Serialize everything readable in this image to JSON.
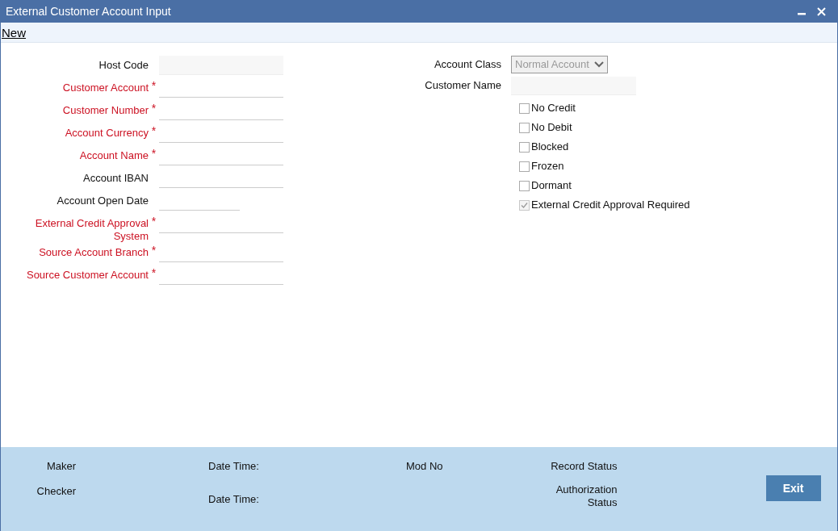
{
  "window": {
    "title": "External Customer Account Input"
  },
  "menu": [
    {
      "label": "New"
    }
  ],
  "left_fields": [
    {
      "label": "Host Code",
      "required": false,
      "kind": "shaded"
    },
    {
      "label": "Customer Account",
      "required": true,
      "asterisk": "*",
      "kind": "line"
    },
    {
      "label": "Customer Number",
      "required": true,
      "asterisk": "*",
      "kind": "line"
    },
    {
      "label": "Account Currency",
      "required": true,
      "asterisk": "*",
      "kind": "line"
    },
    {
      "label": "Account Name",
      "required": true,
      "asterisk": "*",
      "kind": "line"
    },
    {
      "label": "Account IBAN",
      "required": false,
      "kind": "line"
    },
    {
      "label": "Account Open Date",
      "required": false,
      "kind": "date"
    },
    {
      "label": "External Credit Approval System",
      "required": true,
      "asterisk": "*",
      "kind": "line"
    },
    {
      "label": "Source Account Branch",
      "required": true,
      "asterisk": "*",
      "kind": "line"
    },
    {
      "label": "Source Customer Account",
      "required": true,
      "asterisk": "*",
      "kind": "line"
    }
  ],
  "account_class": {
    "label": "Account Class",
    "value": "Normal Account",
    "disabled": true
  },
  "customer_name": {
    "label": "Customer Name"
  },
  "checkboxes": [
    {
      "label": "No Credit",
      "checked": false,
      "disabled": false
    },
    {
      "label": "No Debit",
      "checked": false,
      "disabled": false
    },
    {
      "label": "Blocked",
      "checked": false,
      "disabled": false
    },
    {
      "label": "Frozen",
      "checked": false,
      "disabled": false
    },
    {
      "label": "Dormant",
      "checked": false,
      "disabled": false
    },
    {
      "label": "External Credit Approval Required",
      "checked": true,
      "disabled": true
    }
  ],
  "footer": {
    "maker": "Maker",
    "checker": "Checker",
    "date_time_1": "Date Time:",
    "date_time_2": "Date Time:",
    "mod_no": "Mod No",
    "record_status": "Record Status",
    "authorization_status": "Authorization Status",
    "exit_button": "Exit"
  }
}
